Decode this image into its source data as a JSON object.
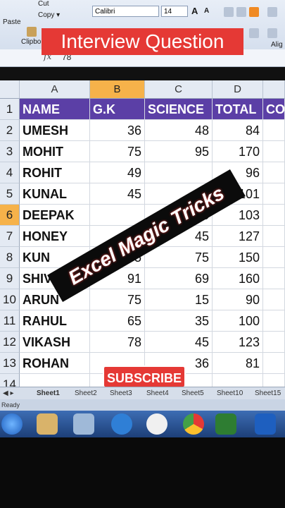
{
  "ribbon": {
    "paste_label": "Paste",
    "cut_label": "Cut",
    "copy_label": "Copy ▾",
    "clipboard_label": "Clipbo",
    "font_name": "Calibri",
    "font_size": "14",
    "align_label": "Alig",
    "grow_label": "A",
    "shrink_label": "A"
  },
  "overlay": {
    "banner": "Interview Question",
    "stamp": "Excel Magic Tricks",
    "subscribe": "SUBSCRIBE"
  },
  "formula_bar": {
    "fx": "fx",
    "value": "78"
  },
  "columns": [
    "A",
    "B",
    "C",
    "D"
  ],
  "row_numbers": [
    "1",
    "2",
    "3",
    "4",
    "5",
    "6",
    "7",
    "8",
    "9",
    "10",
    "11",
    "12",
    "13",
    "14"
  ],
  "headers": {
    "name": "NAME",
    "gk": "G.K",
    "science": "SCIENCE",
    "total": "TOTAL",
    "extra": "CO"
  },
  "rows": [
    {
      "name": "UMESH",
      "gk": "36",
      "science": "48",
      "total": "84"
    },
    {
      "name": "MOHIT",
      "gk": "75",
      "science": "95",
      "total": "170"
    },
    {
      "name": "ROHIT",
      "gk": "49",
      "science": "",
      "total": "96"
    },
    {
      "name": "KUNAL",
      "gk": "45",
      "science": "",
      "total": "101"
    },
    {
      "name": "DEEPAK",
      "gk": "",
      "science": "25",
      "total": "103"
    },
    {
      "name": "HONEY",
      "gk": "",
      "science": "45",
      "total": "127"
    },
    {
      "name": "KUN",
      "gk": "75",
      "science": "75",
      "total": "150"
    },
    {
      "name": "SHIV",
      "gk": "91",
      "science": "69",
      "total": "160"
    },
    {
      "name": "ARUN",
      "gk": "75",
      "science": "15",
      "total": "90"
    },
    {
      "name": "RAHUL",
      "gk": "65",
      "science": "35",
      "total": "100"
    },
    {
      "name": "VIKASH",
      "gk": "78",
      "science": "45",
      "total": "123"
    },
    {
      "name": "ROHAN",
      "gk": "",
      "science": "36",
      "total": "81"
    }
  ],
  "sheet_tabs": [
    "Sheet1",
    "Sheet2",
    "Sheet3",
    "Sheet4",
    "Sheet5",
    "Sheet10",
    "Sheet15"
  ],
  "status": "Ready",
  "colors": {
    "header_purple": "#5b3fa6",
    "accent_red": "#e53935",
    "selected_orange": "#f6b24a"
  }
}
